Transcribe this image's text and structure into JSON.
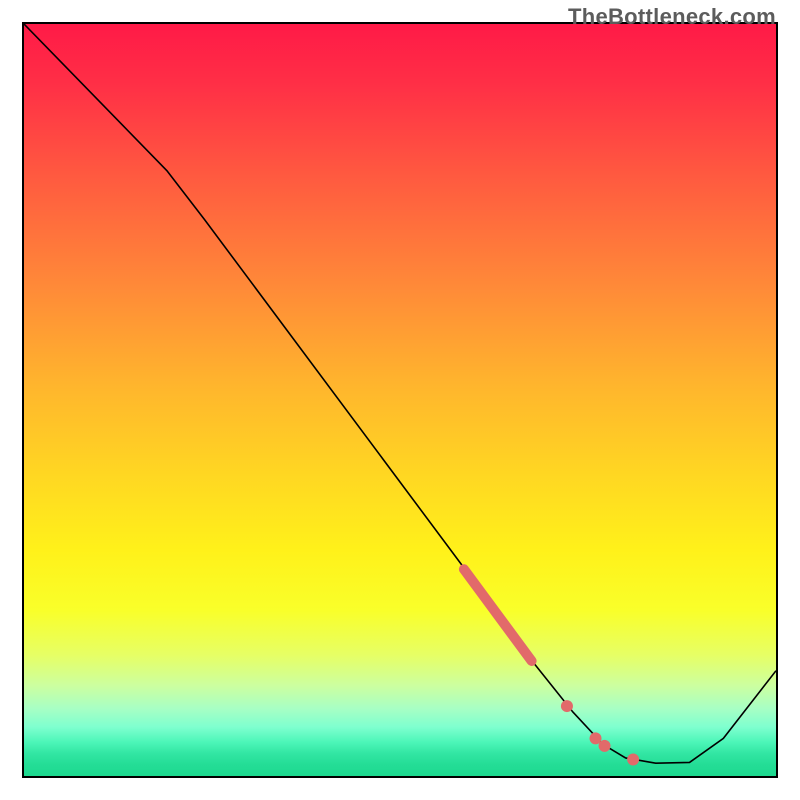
{
  "watermark": "TheBottleneck.com",
  "chart_data": {
    "type": "line",
    "description": "Bottleneck curve over a vertical red-to-green gradient. Lower y indicates better fit (green zone). The black curve descends from top-left, dips to a minimum near the right side, then rises slightly. A cluster of salmon highlight points sits on the descending slope and near the trough.",
    "x_range": [
      0,
      100
    ],
    "y_range": [
      0,
      100
    ],
    "series": [
      {
        "name": "bottleneck-curve",
        "color": "#000000",
        "stroke_width": 1.6,
        "points": [
          {
            "x": 0.0,
            "y": 100.0
          },
          {
            "x": 19.0,
            "y": 80.5
          },
          {
            "x": 24.0,
            "y": 74.0
          },
          {
            "x": 60.5,
            "y": 25.0
          },
          {
            "x": 67.0,
            "y": 16.0
          },
          {
            "x": 73.0,
            "y": 8.5
          },
          {
            "x": 77.0,
            "y": 4.2
          },
          {
            "x": 80.0,
            "y": 2.4
          },
          {
            "x": 84.0,
            "y": 1.7
          },
          {
            "x": 88.5,
            "y": 1.8
          },
          {
            "x": 93.0,
            "y": 5.0
          },
          {
            "x": 100.0,
            "y": 14.0
          }
        ]
      },
      {
        "name": "highlight-segment",
        "type": "segment",
        "color": "#e26a6a",
        "stroke_width": 10,
        "linecap": "round",
        "points": [
          {
            "x": 58.5,
            "y": 27.5
          },
          {
            "x": 67.5,
            "y": 15.3
          }
        ]
      }
    ],
    "highlight_dots": {
      "color": "#e26a6a",
      "radius": 6,
      "points": [
        {
          "x": 72.2,
          "y": 9.3
        },
        {
          "x": 76.0,
          "y": 5.0
        },
        {
          "x": 77.2,
          "y": 4.0
        },
        {
          "x": 81.0,
          "y": 2.2
        }
      ]
    },
    "gradient_stops": [
      {
        "pos": 0.0,
        "color": "#ff1a47"
      },
      {
        "pos": 0.35,
        "color": "#ff8a38"
      },
      {
        "pos": 0.7,
        "color": "#fff11a"
      },
      {
        "pos": 0.88,
        "color": "#ccffa0"
      },
      {
        "pos": 1.0,
        "color": "#1dd98f"
      }
    ]
  }
}
